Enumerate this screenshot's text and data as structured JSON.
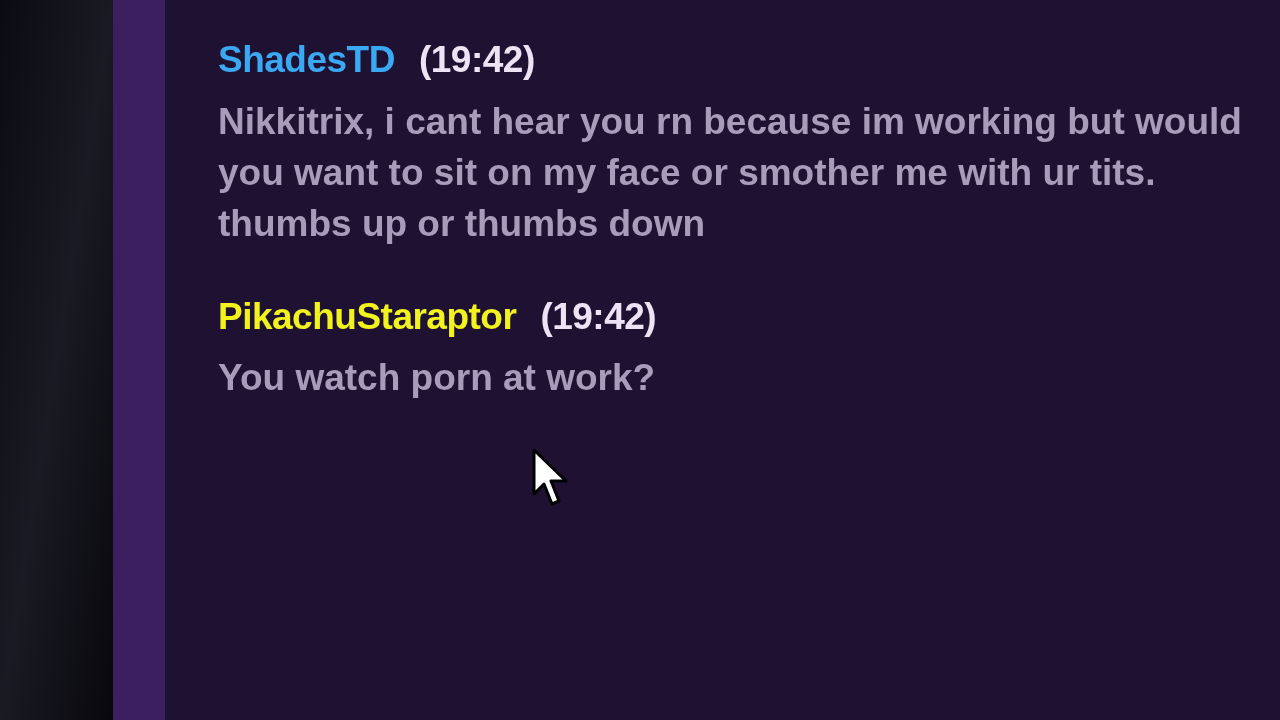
{
  "messages": [
    {
      "author": "ShadesTD",
      "color": "#3aa8f2",
      "time": "(19:42)",
      "text": "Nikkitrix, i cant hear you rn because im working but would you want to sit on my face or smother me with ur tits. thumbs up or thumbs down"
    },
    {
      "author": "PikachuStaraptor",
      "color": "#f2f21e",
      "time": "(19:42)",
      "text": "You watch porn at work?"
    }
  ]
}
